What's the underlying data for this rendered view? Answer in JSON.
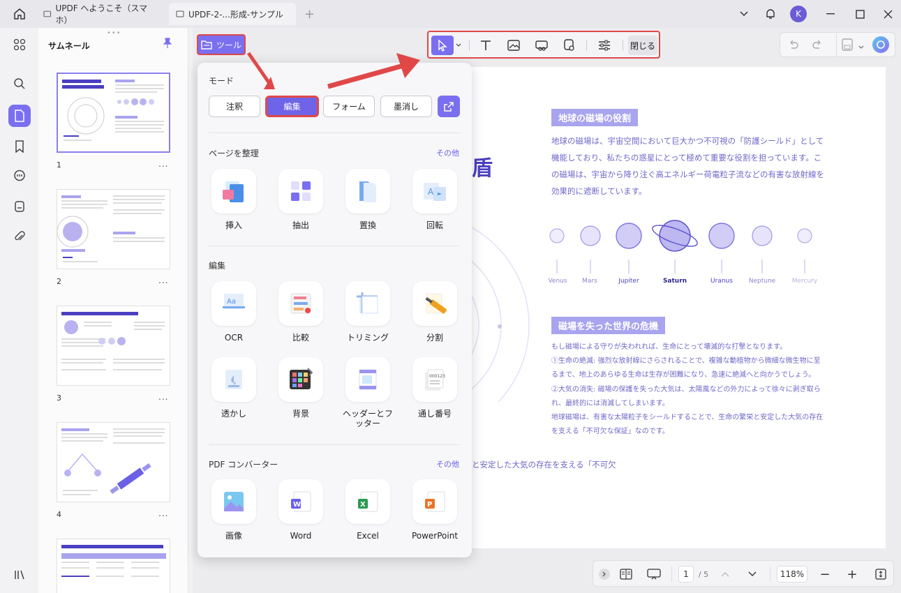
{
  "titlebar": {
    "tabs": [
      {
        "label": "UPDF へようこそ（スマホ）"
      },
      {
        "label": "UPDF-2-...形成-サンプル"
      }
    ],
    "avatar_letter": "K"
  },
  "sidebar": {
    "title": "サムネール",
    "pages": [
      "1",
      "2",
      "3",
      "4"
    ],
    "more": "..."
  },
  "toolbar": {
    "tools_label": "ツール",
    "close_label": "閉じる"
  },
  "popup": {
    "mode_title": "モード",
    "modes": [
      "注釈",
      "編集",
      "フォーム",
      "墨消し"
    ],
    "organize_title": "ページを整理",
    "edit_title": "編集",
    "converter_title": "PDF コンバーター",
    "more_label": "その他",
    "organize_tools": [
      "挿入",
      "抽出",
      "置換",
      "回転"
    ],
    "edit_tools": [
      "OCR",
      "比較",
      "トリミング",
      "分割",
      "透かし",
      "背景",
      "ヘッダーとフッター",
      "通し番号"
    ],
    "converter_tools": [
      "画像",
      "Word",
      "Excel",
      "PowerPoint"
    ]
  },
  "document": {
    "heading1": "地球の磁場の役割",
    "para1": [
      "地球の磁場は、宇宙空間において巨大かつ不可視の「防護シールド」として",
      "機能しており、私たちの惑星にとって極めて重要な役割を担っています。こ",
      "の磁場は、宇宙から降り注ぐ高エネルギー荷電粒子流などの有害な放射線を",
      "効果的に遮断しています。"
    ],
    "big_char": "盾",
    "planets": [
      "Venus",
      "Mars",
      "Jupiter",
      "Saturn",
      "Uranus",
      "Neptune",
      "Mercury"
    ],
    "heading2": "磁場を失った世界の危機",
    "para2": [
      "もし磁場による守りが失われれば、生命にとって壊滅的な打撃となります。",
      "①生命の絶滅: 強烈な放射線にさらされることで、複雑な動植物から微細な微生物に至",
      "るまで、地上のあらゆる生命は生存が困難になり、急速に絶滅へと向かうでしょう。",
      "②大気の消失: 磁場の保護を失った大気は、太陽風などの外力によって徐々に剥ぎ取ら",
      "れ、最終的には消滅してしまいます。",
      "地球磁場は、有害な太陽粒子をシールドすることで、生命の繁栄と安定した大気の存在",
      "を支える「不可欠な保証」なのです。"
    ],
    "bottom_text": "と安定した大気の存在を支える「不可欠"
  },
  "bottombar": {
    "page_current": "1",
    "page_total": "/ 5",
    "zoom": "118%"
  },
  "colors": {
    "accent": "#7a6ff0",
    "highlight": "#e04848",
    "doc_text": "#7068c8"
  }
}
